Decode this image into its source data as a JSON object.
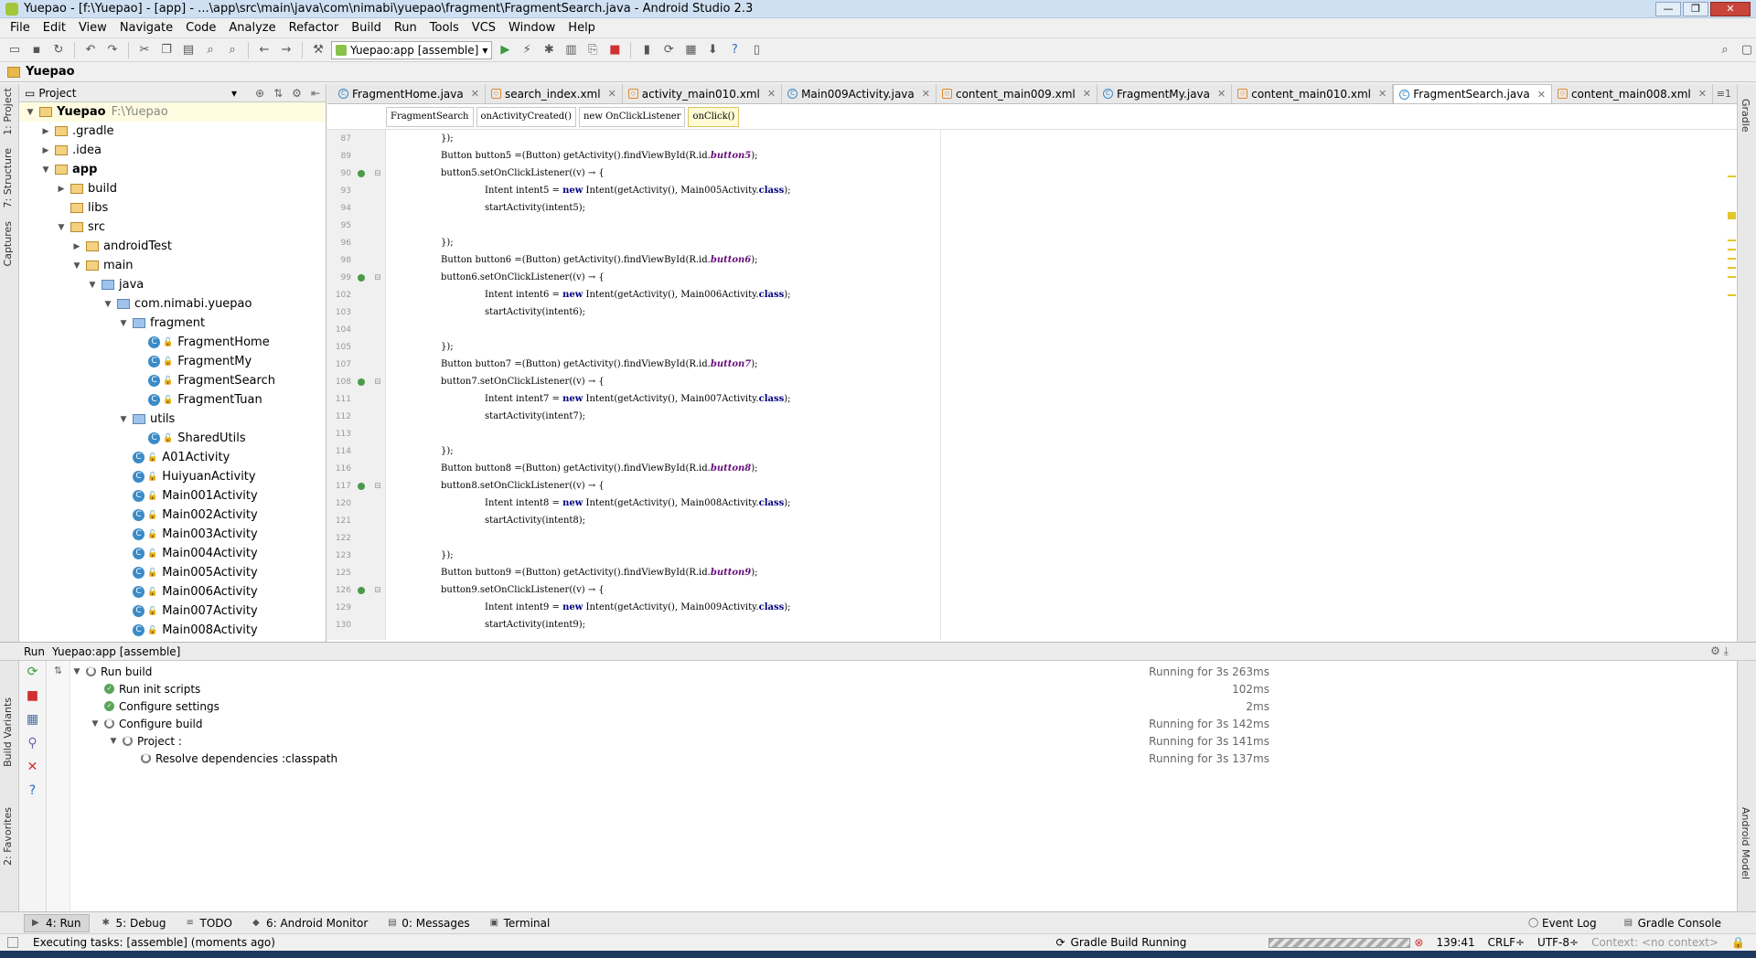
{
  "window": {
    "title": "Yuepao - [f:\\Yuepao] - [app] - ...\\app\\src\\main\\java\\com\\nimabi\\yuepao\\fragment\\FragmentSearch.java - Android Studio 2.3",
    "controls": [
      "—",
      "❐",
      "✕"
    ]
  },
  "menu": [
    "File",
    "Edit",
    "View",
    "Navigate",
    "Code",
    "Analyze",
    "Refactor",
    "Build",
    "Run",
    "Tools",
    "VCS",
    "Window",
    "Help"
  ],
  "toolbar": {
    "run_config": "Yuepao:app [assemble]"
  },
  "breadcrumb": {
    "project": "Yuepao"
  },
  "project_panel": {
    "view_selector": "Project",
    "tree": [
      {
        "label": "Yuepao",
        "extra": "F:\\Yuepao",
        "depth": 0,
        "arrow": "▼",
        "type": "folder",
        "bold": true
      },
      {
        "label": ".gradle",
        "extra": "",
        "depth": 1,
        "arrow": "▶",
        "type": "folder"
      },
      {
        "label": ".idea",
        "extra": "",
        "depth": 1,
        "arrow": "▶",
        "type": "folder"
      },
      {
        "label": "app",
        "extra": "",
        "depth": 1,
        "arrow": "▼",
        "type": "folder",
        "bold": true
      },
      {
        "label": "build",
        "extra": "",
        "depth": 2,
        "arrow": "▶",
        "type": "folder"
      },
      {
        "label": "libs",
        "extra": "",
        "depth": 2,
        "arrow": "",
        "type": "folder"
      },
      {
        "label": "src",
        "extra": "",
        "depth": 2,
        "arrow": "▼",
        "type": "folder"
      },
      {
        "label": "androidTest",
        "extra": "",
        "depth": 3,
        "arrow": "▶",
        "type": "folder"
      },
      {
        "label": "main",
        "extra": "",
        "depth": 3,
        "arrow": "▼",
        "type": "folder"
      },
      {
        "label": "java",
        "extra": "",
        "depth": 4,
        "arrow": "▼",
        "type": "srcfolder"
      },
      {
        "label": "com.nimabi.yuepao",
        "extra": "",
        "depth": 5,
        "arrow": "▼",
        "type": "package"
      },
      {
        "label": "fragment",
        "extra": "",
        "depth": 6,
        "arrow": "▼",
        "type": "package"
      },
      {
        "label": "FragmentHome",
        "extra": "",
        "depth": 7,
        "arrow": "",
        "type": "class"
      },
      {
        "label": "FragmentMy",
        "extra": "",
        "depth": 7,
        "arrow": "",
        "type": "class"
      },
      {
        "label": "FragmentSearch",
        "extra": "",
        "depth": 7,
        "arrow": "",
        "type": "class"
      },
      {
        "label": "FragmentTuan",
        "extra": "",
        "depth": 7,
        "arrow": "",
        "type": "class"
      },
      {
        "label": "utils",
        "extra": "",
        "depth": 6,
        "arrow": "▼",
        "type": "package"
      },
      {
        "label": "SharedUtils",
        "extra": "",
        "depth": 7,
        "arrow": "",
        "type": "class"
      },
      {
        "label": "A01Activity",
        "extra": "",
        "depth": 6,
        "arrow": "",
        "type": "class"
      },
      {
        "label": "HuiyuanActivity",
        "extra": "",
        "depth": 6,
        "arrow": "",
        "type": "class"
      },
      {
        "label": "Main001Activity",
        "extra": "",
        "depth": 6,
        "arrow": "",
        "type": "class"
      },
      {
        "label": "Main002Activity",
        "extra": "",
        "depth": 6,
        "arrow": "",
        "type": "class"
      },
      {
        "label": "Main003Activity",
        "extra": "",
        "depth": 6,
        "arrow": "",
        "type": "class"
      },
      {
        "label": "Main004Activity",
        "extra": "",
        "depth": 6,
        "arrow": "",
        "type": "class"
      },
      {
        "label": "Main005Activity",
        "extra": "",
        "depth": 6,
        "arrow": "",
        "type": "class"
      },
      {
        "label": "Main006Activity",
        "extra": "",
        "depth": 6,
        "arrow": "",
        "type": "class"
      },
      {
        "label": "Main007Activity",
        "extra": "",
        "depth": 6,
        "arrow": "",
        "type": "class"
      },
      {
        "label": "Main008Activity",
        "extra": "",
        "depth": 6,
        "arrow": "",
        "type": "class"
      }
    ]
  },
  "left_strip": [
    "1: Project",
    "7: Structure",
    "Captures"
  ],
  "right_strip": [
    "Gradle"
  ],
  "editor": {
    "tabs": [
      {
        "label": "FragmentHome.java",
        "kind": "java",
        "active": false
      },
      {
        "label": "search_index.xml",
        "kind": "xml",
        "active": false
      },
      {
        "label": "activity_main010.xml",
        "kind": "xml",
        "active": false
      },
      {
        "label": "Main009Activity.java",
        "kind": "java",
        "active": false
      },
      {
        "label": "content_main009.xml",
        "kind": "xml",
        "active": false
      },
      {
        "label": "FragmentMy.java",
        "kind": "java",
        "active": false
      },
      {
        "label": "content_main010.xml",
        "kind": "xml",
        "active": false
      },
      {
        "label": "FragmentSearch.java",
        "kind": "java",
        "active": true
      },
      {
        "label": "content_main008.xml",
        "kind": "xml",
        "active": false
      }
    ],
    "tab_menu": "≡1",
    "crumbs": [
      "FragmentSearch",
      "onActivityCreated()",
      "new OnClickListener",
      "onClick()"
    ],
    "lines": [
      {
        "n": "87",
        "indent": 1,
        "html": "});",
        "mark": false
      },
      {
        "n": "89",
        "indent": 1,
        "html": "Button button5 =(Button) getActivity().findViewById(R.id.<i>button5</i>);",
        "mark": false
      },
      {
        "n": "90",
        "indent": 1,
        "html": "button5.setOnClickListener((v) → {",
        "mark": true
      },
      {
        "n": "93",
        "indent": 2,
        "html": "Intent intent5 = <b>new</b> Intent(getActivity(), Main005Activity.<b>class</b>);",
        "mark": false
      },
      {
        "n": "94",
        "indent": 2,
        "html": "startActivity(intent5);",
        "mark": false
      },
      {
        "n": "95",
        "indent": 0,
        "html": "",
        "mark": false
      },
      {
        "n": "96",
        "indent": 1,
        "html": "});",
        "mark": false
      },
      {
        "n": "98",
        "indent": 1,
        "html": "Button button6 =(Button) getActivity().findViewById(R.id.<i>button6</i>);",
        "mark": false
      },
      {
        "n": "99",
        "indent": 1,
        "html": "button6.setOnClickListener((v) → {",
        "mark": true
      },
      {
        "n": "102",
        "indent": 2,
        "html": "Intent intent6 = <b>new</b> Intent(getActivity(), Main006Activity.<b>class</b>);",
        "mark": false
      },
      {
        "n": "103",
        "indent": 2,
        "html": "startActivity(intent6);",
        "mark": false
      },
      {
        "n": "104",
        "indent": 0,
        "html": "",
        "mark": false
      },
      {
        "n": "105",
        "indent": 1,
        "html": "});",
        "mark": false
      },
      {
        "n": "107",
        "indent": 1,
        "html": "Button button7 =(Button) getActivity().findViewById(R.id.<i>button7</i>);",
        "mark": false
      },
      {
        "n": "108",
        "indent": 1,
        "html": "button7.setOnClickListener((v) → {",
        "mark": true
      },
      {
        "n": "111",
        "indent": 2,
        "html": "Intent intent7 = <b>new</b> Intent(getActivity(), Main007Activity.<b>class</b>);",
        "mark": false
      },
      {
        "n": "112",
        "indent": 2,
        "html": "startActivity(intent7);",
        "mark": false
      },
      {
        "n": "113",
        "indent": 0,
        "html": "",
        "mark": false
      },
      {
        "n": "114",
        "indent": 1,
        "html": "});",
        "mark": false
      },
      {
        "n": "116",
        "indent": 1,
        "html": "Button button8 =(Button) getActivity().findViewById(R.id.<i>button8</i>);",
        "mark": false
      },
      {
        "n": "117",
        "indent": 1,
        "html": "button8.setOnClickListener((v) → {",
        "mark": true
      },
      {
        "n": "120",
        "indent": 2,
        "html": "Intent intent8 = <b>new</b> Intent(getActivity(), Main008Activity.<b>class</b>);",
        "mark": false
      },
      {
        "n": "121",
        "indent": 2,
        "html": "startActivity(intent8);",
        "mark": false
      },
      {
        "n": "122",
        "indent": 0,
        "html": "",
        "mark": false
      },
      {
        "n": "123",
        "indent": 1,
        "html": "});",
        "mark": false
      },
      {
        "n": "125",
        "indent": 1,
        "html": "Button button9 =(Button) getActivity().findViewById(R.id.<i>button9</i>);",
        "mark": false
      },
      {
        "n": "126",
        "indent": 1,
        "html": "button9.setOnClickListener((v) → {",
        "mark": true
      },
      {
        "n": "129",
        "indent": 2,
        "html": "Intent intent9 = <b>new</b> Intent(getActivity(), Main009Activity.<b>class</b>);",
        "mark": false
      },
      {
        "n": "130",
        "indent": 2,
        "html": "startActivity(intent9);",
        "mark": false
      }
    ]
  },
  "run_panel": {
    "header_label": "Run",
    "header_config": "Yuepao:app [assemble]",
    "rows": [
      {
        "label": "Run build",
        "time": "Running for 3s 263ms",
        "depth": 0,
        "arrow": "▼",
        "status": "running"
      },
      {
        "label": "Run init scripts",
        "time": "102ms",
        "depth": 1,
        "arrow": "",
        "status": "ok"
      },
      {
        "label": "Configure settings",
        "time": "2ms",
        "depth": 1,
        "arrow": "",
        "status": "ok"
      },
      {
        "label": "Configure build",
        "time": "Running for 3s 142ms",
        "depth": 1,
        "arrow": "▼",
        "status": "running"
      },
      {
        "label": "Project :",
        "time": "Running for 3s 141ms",
        "depth": 2,
        "arrow": "▼",
        "status": "running"
      },
      {
        "label": "Resolve dependencies :classpath",
        "time": "Running for 3s 137ms",
        "depth": 3,
        "arrow": "",
        "status": "running"
      }
    ]
  },
  "bottom_left_strip": [
    "Build Variants",
    "2: Favorites"
  ],
  "bottom_right_strip": [
    "Android Model"
  ],
  "tool_windows": [
    {
      "label": "4: Run",
      "icon": "▶",
      "active": true
    },
    {
      "label": "5: Debug",
      "icon": "✱",
      "active": false
    },
    {
      "label": "TODO",
      "icon": "≡",
      "active": false
    },
    {
      "label": "6: Android Monitor",
      "icon": "◆",
      "active": false
    },
    {
      "label": "0: Messages",
      "icon": "▤",
      "active": false
    },
    {
      "label": "Terminal",
      "icon": "▣",
      "active": false
    }
  ],
  "tool_windows_right": [
    "Event Log",
    "Gradle Console"
  ],
  "status": {
    "left": "Executing tasks: [assemble] (moments ago)",
    "center": "Gradle Build Running",
    "position": "139:41",
    "line_sep": "CRLF÷",
    "encoding": "UTF-8÷",
    "context": "Context: <no context>"
  }
}
